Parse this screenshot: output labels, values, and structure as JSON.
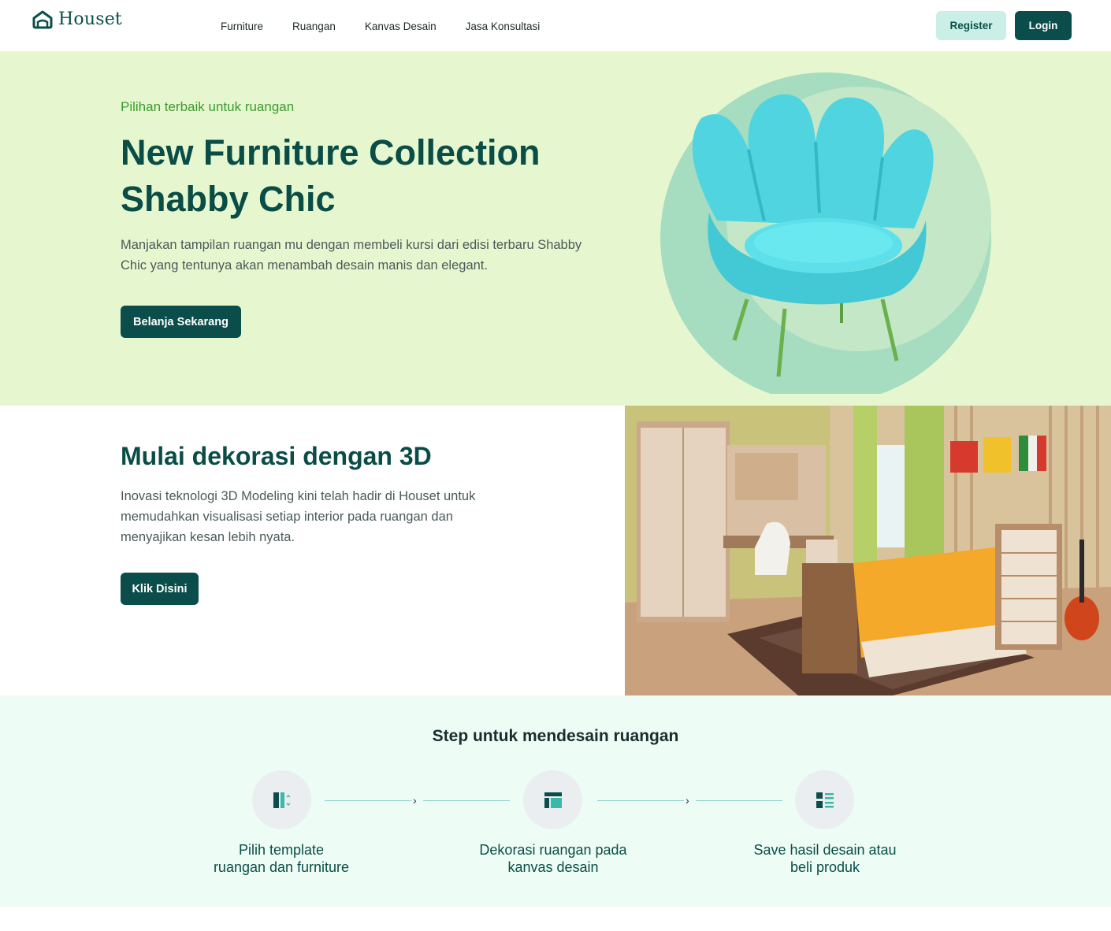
{
  "brand": {
    "name": "Houset"
  },
  "nav": {
    "items": [
      "Furniture",
      "Ruangan",
      "Kanvas Desain",
      "Jasa Konsultasi"
    ],
    "register_label": "Register",
    "login_label": "Login"
  },
  "hero": {
    "kicker": "Pilihan terbaik untuk ruangan",
    "title_line1": "New Furniture Collection",
    "title_line2": "Shabby Chic",
    "description": "Manjakan tampilan ruangan mu dengan membeli kursi dari edisi terbaru Shabby Chic yang tentunya akan menambah desain manis dan elegant.",
    "cta_label": "Belanja Sekarang"
  },
  "decor": {
    "title": "Mulai dekorasi dengan 3D",
    "description": "Inovasi teknologi 3D Modeling kini telah hadir di Houset untuk memudahkan visualisasi setiap interior pada ruangan dan menyajikan kesan lebih nyata.",
    "cta_label": "Klik Disini"
  },
  "steps": {
    "title": "Step untuk mendesain ruangan",
    "items": [
      {
        "line1": "Pilih template",
        "line2": "ruangan dan furniture",
        "icon": "template-icon"
      },
      {
        "line1": "Dekorasi ruangan pada",
        "line2": "kanvas desain",
        "icon": "canvas-layout-icon"
      },
      {
        "line1": "Save hasil desain atau",
        "line2": "beli produk",
        "icon": "list-icon"
      }
    ]
  },
  "colors": {
    "primary": "#0a4d4a",
    "hero_bg": "#e6f7cf",
    "steps_bg": "#eefcf6",
    "register_bg": "#c9efe6",
    "kicker": "#3d9a2e"
  }
}
